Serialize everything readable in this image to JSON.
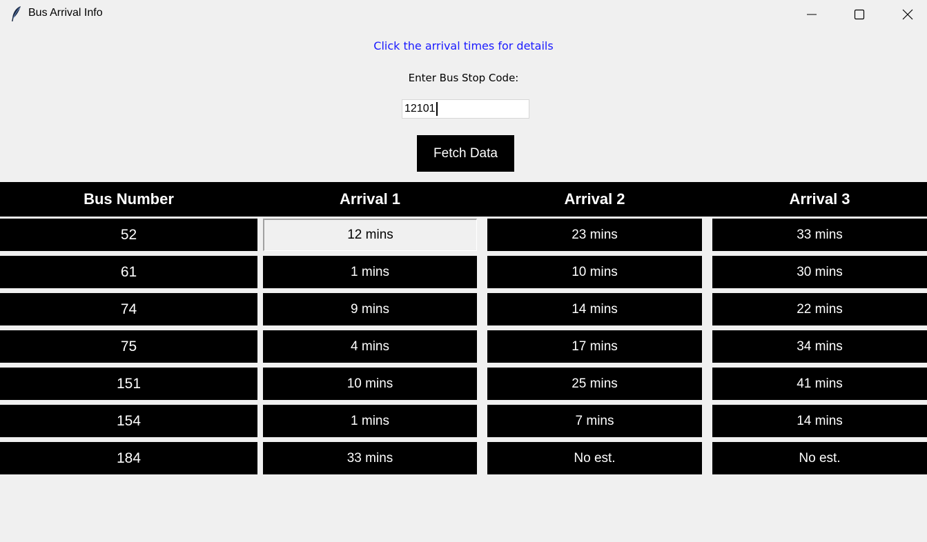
{
  "window": {
    "title": "Bus Arrival Info",
    "icon": "feather-icon",
    "controls": [
      "minimize-icon",
      "maximize-icon",
      "close-icon"
    ]
  },
  "hint": "Click the arrival times for details",
  "stop_label": "Enter Bus Stop Code:",
  "stop_input": {
    "value": "12101"
  },
  "fetch_button": "Fetch Data",
  "colors": {
    "hint": "#1a1aff",
    "cell_bg": "#000000",
    "cell_text": "#ffffff",
    "window_bg": "#f0f0f0"
  },
  "table": {
    "headers": [
      "Bus Number",
      "Arrival 1",
      "Arrival 2",
      "Arrival 3"
    ],
    "selected": {
      "row": 0,
      "col": 1
    },
    "rows": [
      [
        "52",
        "12 mins",
        "23 mins",
        "33 mins"
      ],
      [
        "61",
        "1 mins",
        "10 mins",
        "30 mins"
      ],
      [
        "74",
        "9 mins",
        "14 mins",
        "22 mins"
      ],
      [
        "75",
        "4 mins",
        "17 mins",
        "34 mins"
      ],
      [
        "151",
        "10 mins",
        "25 mins",
        "41 mins"
      ],
      [
        "154",
        "1 mins",
        "7 mins",
        "14 mins"
      ],
      [
        "184",
        "33 mins",
        "No est.",
        "No est."
      ]
    ]
  }
}
